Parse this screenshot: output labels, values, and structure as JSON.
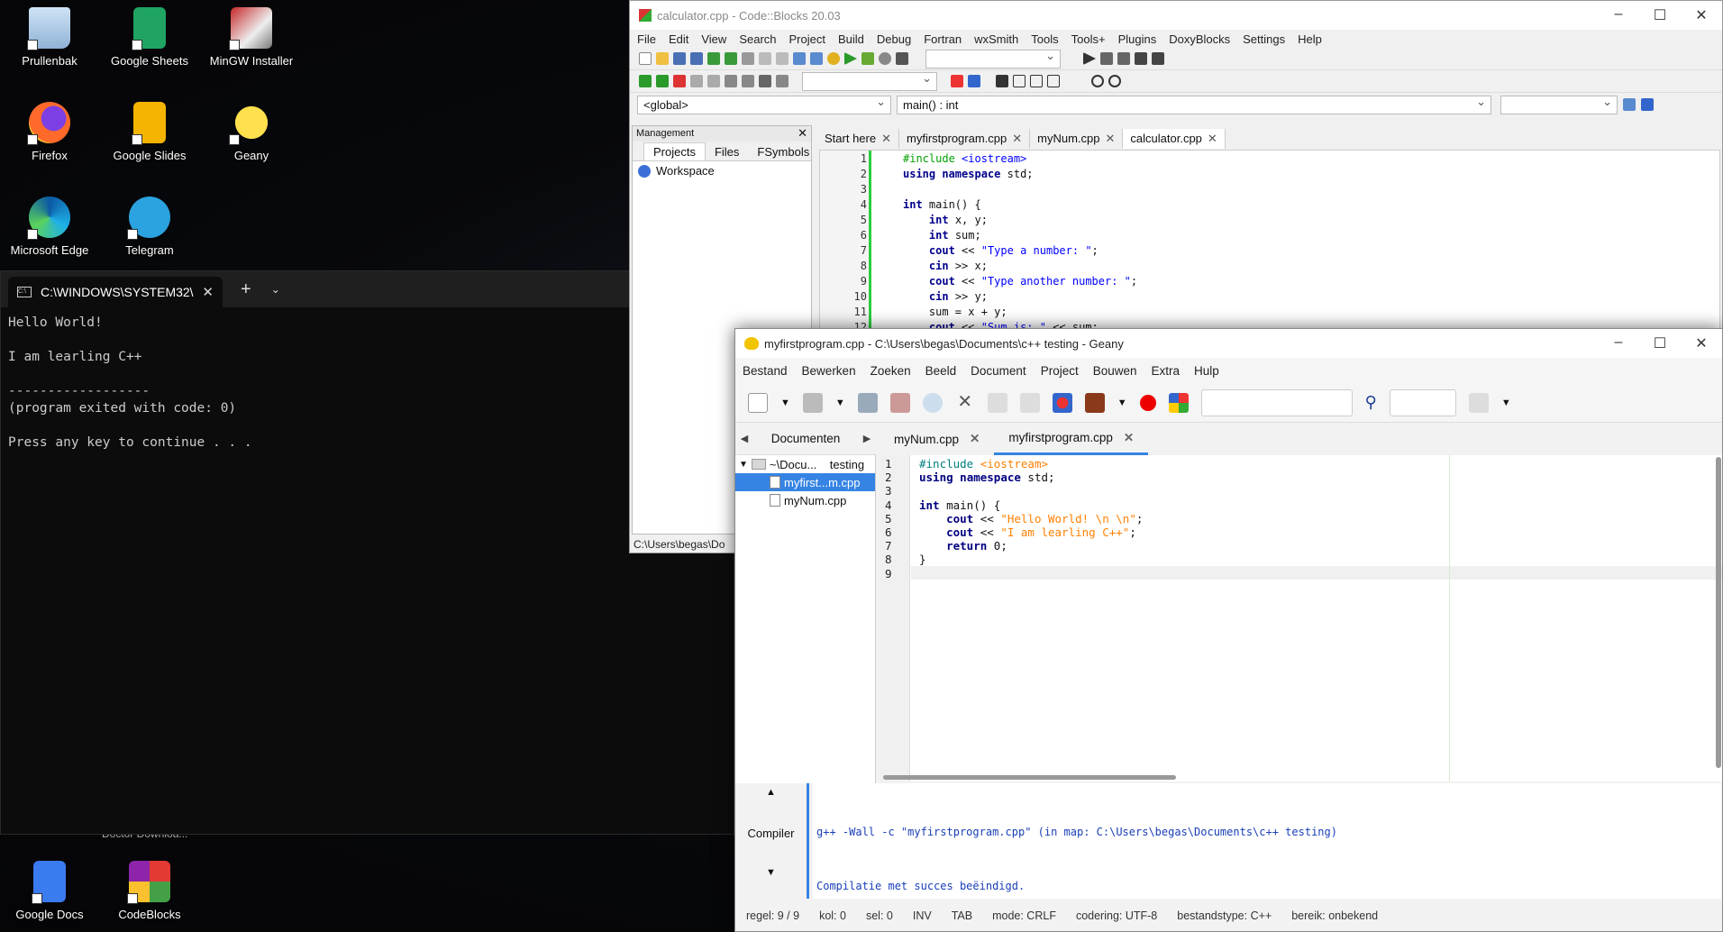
{
  "desktop": {
    "icons": [
      {
        "label": "Prullenbak"
      },
      {
        "label": "Google Sheets"
      },
      {
        "label": "MinGW Installer"
      },
      {
        "label": "Firefox"
      },
      {
        "label": "Google Slides"
      },
      {
        "label": "Geany"
      },
      {
        "label": "Microsoft Edge"
      },
      {
        "label": "Telegram"
      },
      {
        "label": "Google Docs"
      },
      {
        "label": "CodeBlocks"
      }
    ],
    "hidden_label": "Doctor Downloa..."
  },
  "terminal": {
    "tab_title": "C:\\WINDOWS\\SYSTEM32\\",
    "output": "Hello World!\n\nI am learling C++\n\n------------------\n(program exited with code: 0)\n\nPress any key to continue . . ."
  },
  "codeblocks": {
    "title": "calculator.cpp - Code::Blocks 20.03",
    "menu": [
      "File",
      "Edit",
      "View",
      "Search",
      "Project",
      "Build",
      "Debug",
      "Fortran",
      "wxSmith",
      "Tools",
      "Tools+",
      "Plugins",
      "DoxyBlocks",
      "Settings",
      "Help"
    ],
    "scope_combo": "<global>",
    "function_combo": "main() : int",
    "management": {
      "header": "Management",
      "tabs": [
        "Projects",
        "Files",
        "FSymbols"
      ],
      "workspace": "Workspace"
    },
    "editor_tabs": [
      "Start here",
      "myfirstprogram.cpp",
      "myNum.cpp",
      "calculator.cpp"
    ],
    "active_tab": "calculator.cpp",
    "status_path": "C:\\Users\\begas\\Do",
    "code_lines": [
      "#include <iostream>",
      "using namespace std;",
      "",
      "int main() {",
      "    int x, y;",
      "    int sum;",
      "    cout << \"Type a number: \";",
      "    cin >> x;",
      "    cout << \"Type another number: \";",
      "    cin >> y;",
      "    sum = x + y;",
      "    cout << \"Sum is: \" << sum;"
    ]
  },
  "geany": {
    "title": "myfirstprogram.cpp - C:\\Users\\begas\\Documents\\c++ testing - Geany",
    "menu": [
      "Bestand",
      "Bewerken",
      "Zoeken",
      "Beeld",
      "Document",
      "Project",
      "Bouwen",
      "Extra",
      "Hulp"
    ],
    "sidebar_tab": "Documenten",
    "tree": {
      "folder": "~\\Docu...    testing",
      "files": [
        "myfirst...m.cpp",
        "myNum.cpp"
      ]
    },
    "doc_tabs": [
      "myNum.cpp",
      "myfirstprogram.cpp"
    ],
    "active_doc": "myfirstprogram.cpp",
    "code_lines": [
      "#include <iostream>",
      "using namespace std;",
      "",
      "int main() {",
      "    cout << \"Hello World! \\n \\n\";",
      "    cout << \"I am learling C++\";",
      "    return 0;",
      "}",
      ""
    ],
    "messages_label": "Compiler",
    "messages": [
      "g++ -Wall -c \"myfirstprogram.cpp\" (in map: C:\\Users\\begas\\Documents\\c++ testing)",
      "Compilatie met succes beëindigd."
    ],
    "status": {
      "line": "regel: 9 / 9",
      "col": "kol: 0",
      "sel": "sel: 0",
      "mode_ins": "INV",
      "indent": "TAB",
      "eol": "mode: CRLF",
      "encoding": "codering: UTF-8",
      "filetype": "bestandstype: C++",
      "scope": "bereik: onbekend"
    }
  }
}
